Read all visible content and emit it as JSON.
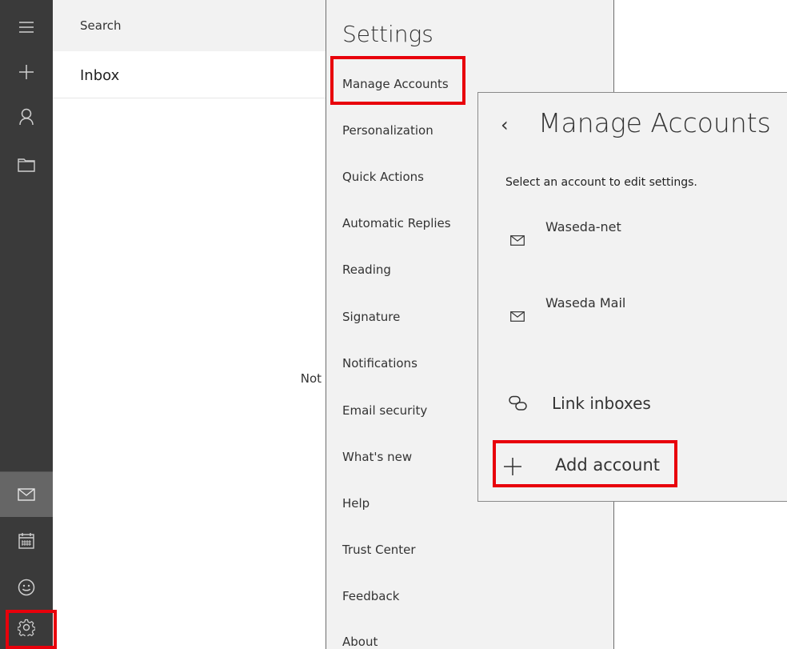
{
  "colors": {
    "rail_bg": "#3a3a3a",
    "rail_active": "#666666",
    "pane_bg": "#f2f2f2",
    "highlight": "#e8000b"
  },
  "rail": {
    "icons": [
      "hamburger-menu-icon",
      "new-mail-plus-icon",
      "person-icon",
      "folder-icon",
      "mail-icon",
      "calendar-icon",
      "smiley-feedback-icon",
      "gear-icon"
    ],
    "active": "mail-icon"
  },
  "list_pane": {
    "search_label": "Search",
    "folder_title": "Inbox",
    "truncated_text": "Not"
  },
  "settings": {
    "title": "Settings",
    "items": [
      "Manage Accounts",
      "Personalization",
      "Quick Actions",
      "Automatic Replies",
      "Reading",
      "Signature",
      "Notifications",
      "Email security",
      "What's new",
      "Help",
      "Trust Center",
      "Feedback",
      "About"
    ]
  },
  "accounts_panel": {
    "back_glyph": "‹",
    "title": "Manage Accounts",
    "instruction": "Select an account to edit settings.",
    "accounts": [
      "Waseda-net",
      "Waseda Mail"
    ],
    "link_inboxes": "Link inboxes",
    "add_account": "Add account"
  }
}
